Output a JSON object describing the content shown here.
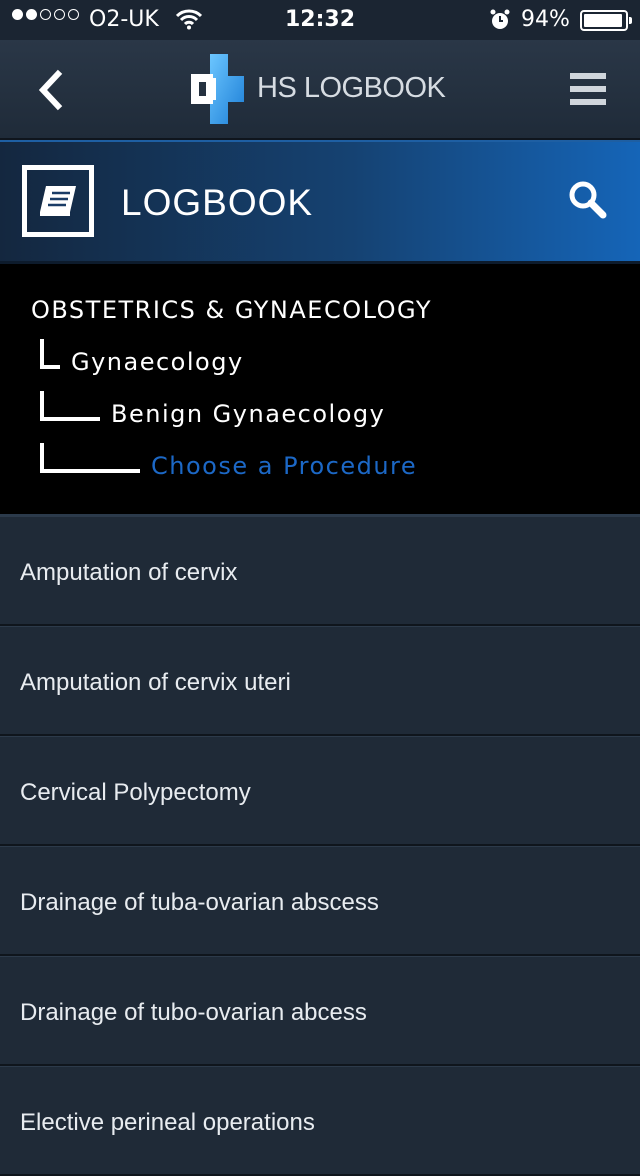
{
  "status_bar": {
    "carrier": "O2-UK",
    "signal_bars": 2,
    "signal_total": 5,
    "time": "12:32",
    "battery_text": "94%",
    "battery_level": 0.94
  },
  "header": {
    "app_name": "HS LOGBOOK",
    "back_icon": "chevron-left-icon",
    "menu_icon": "hamburger-menu-icon",
    "logo_icon": "medical-cross-logo"
  },
  "section": {
    "title": "LOGBOOK",
    "icon": "book-icon",
    "search_icon": "search-icon"
  },
  "breadcrumb": {
    "root": "OBSTETRICS & GYNAECOLOGY",
    "level1": "Gynaecology",
    "level2": "Benign Gynaecology",
    "level3": "Choose a Procedure"
  },
  "procedures": [
    "Amputation of cervix",
    "Amputation of cervix uteri",
    "Cervical Polypectomy",
    "Drainage of tuba-ovarian abscess",
    "Drainage of tubo-ovarian abcess",
    "Elective perineal operations"
  ],
  "colors": {
    "accent_blue": "#1c68c6",
    "banner_blue": "#1565b8",
    "background": "#1e2a38"
  }
}
